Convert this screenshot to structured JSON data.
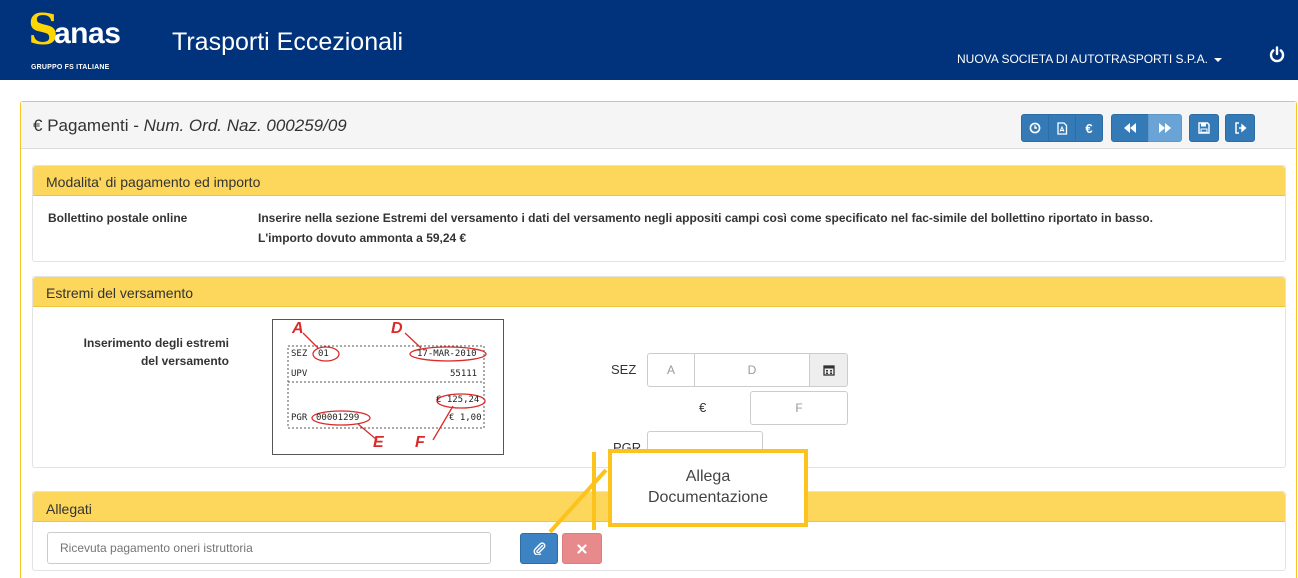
{
  "brand": {
    "logo_letter": "S",
    "logo_name": "anas",
    "logo_sub": "GRUPPO FS ITALIANE",
    "app_title": "Trasporti Eccezionali"
  },
  "user_menu": "NUOVA SOCIETA DI AUTOTRASPORTI S.P.A.",
  "page": {
    "currency_symbol": "€",
    "title": "Pagamenti - ",
    "subtitle": "Num. Ord. Naz. 000259/09"
  },
  "toolbar": {
    "euro_label": "€"
  },
  "payment": {
    "heading": "Modalita' di pagamento ed importo",
    "method": "Bollettino postale online",
    "instructions": "Inserire nella sezione Estremi del versamento i dati del versamento negli appositi campi così come specificato nel fac-simile del bollettino riportato in basso.",
    "amount_line": "L'importo dovuto ammonta a 59,24 €"
  },
  "estremi": {
    "heading": "Estremi del versamento",
    "label_line1": "Inserimento degli estremi",
    "label_line2": "del versamento",
    "sez_label": "SEZ",
    "euro_label": "€",
    "pgr_label": "PGR",
    "field_a": "A",
    "field_d": "D",
    "field_f": "F",
    "field_e": "E"
  },
  "bollettino": {
    "letter_a": "A",
    "letter_d": "D",
    "letter_e": "E",
    "letter_f": "F",
    "sez": "SEZ",
    "sez_val": "01",
    "date": "17-MAR-2010",
    "upv": "UPV",
    "upv_val": "55111",
    "amount": "€ 125,24",
    "fee": "€ 1,00",
    "pgr": "PGR",
    "pgr_val": "00001299"
  },
  "allegati": {
    "heading": "Allegati",
    "placeholder": "Ricevuta pagamento oneri istruttoria"
  },
  "callout": {
    "line1": "Allega",
    "line2": "Documentazione"
  },
  "colors": {
    "navbar": "#00337c",
    "accent": "#fcd75c",
    "primary": "#337ab7",
    "danger": "#e8898b"
  }
}
